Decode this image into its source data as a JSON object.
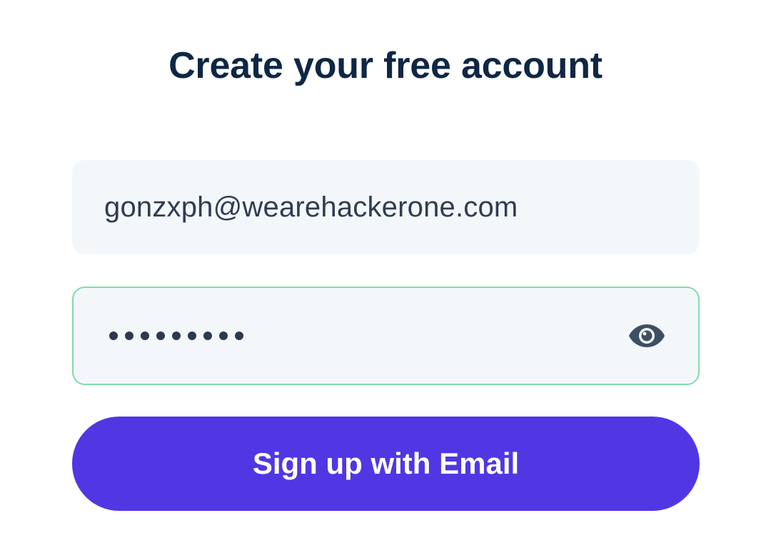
{
  "header": {
    "title": "Create your free account"
  },
  "form": {
    "email": {
      "value": "gonzxph@wearehackerone.com"
    },
    "password": {
      "masked_length": 9,
      "reveal_icon": "eye-icon"
    },
    "submit_label": "Sign up with Email"
  },
  "colors": {
    "title": "#0f2744",
    "field_bg": "#f4f7fa",
    "focus_border": "#7fdcaa",
    "button_bg": "#5137e3",
    "button_text": "#ffffff"
  }
}
